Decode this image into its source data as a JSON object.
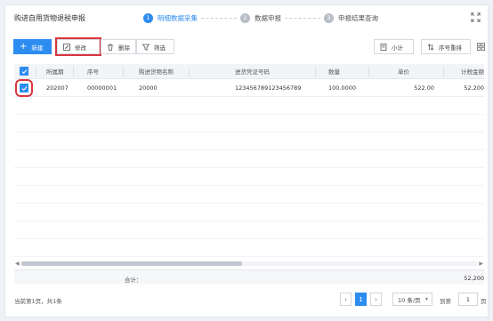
{
  "header": {
    "title": "购进自用货物退税申报",
    "steps": [
      {
        "num": "1",
        "label": "明细数据采集",
        "active": true
      },
      {
        "num": "2",
        "label": "数据申报",
        "active": false
      },
      {
        "num": "3",
        "label": "申报结果查询",
        "active": false
      }
    ]
  },
  "toolbar": {
    "new_label": "新建",
    "edit_label": "修改",
    "delete_label": "删除",
    "filter_label": "筛选",
    "subtotal_label": "小计",
    "sort_label": "序号重排"
  },
  "table": {
    "columns": [
      "所属期",
      "序号",
      "购进货物名称",
      "进货凭证号码",
      "数量",
      "单价",
      "计税金额"
    ],
    "rows": [
      {
        "checked": true,
        "period": "202007",
        "seq": "00000001",
        "goods": "20000",
        "voucher": "123456789123456789",
        "qty": "100.0000",
        "price": "522.00",
        "tax_amount": "52,200"
      }
    ]
  },
  "totals": {
    "label": "合计：",
    "tax_amount": "52,200"
  },
  "pagination": {
    "info": "当前第1页，共1条",
    "current_page": "1",
    "page_size": "10 条/页",
    "goto_label": "到第",
    "goto_value": "1",
    "goto_suffix": "页"
  },
  "colors": {
    "accent": "#2d8cf0",
    "highlight": "#d9363e"
  }
}
